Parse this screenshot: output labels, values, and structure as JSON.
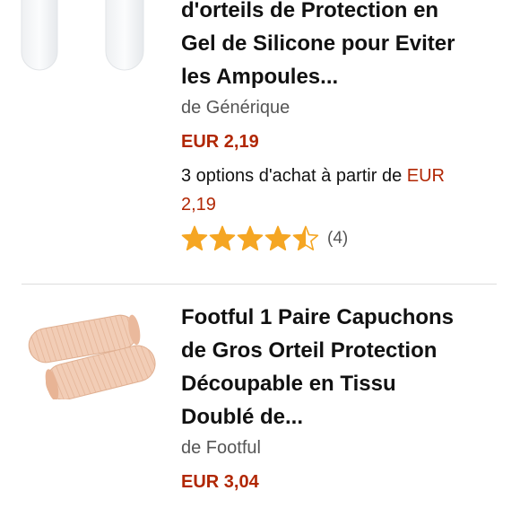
{
  "products": [
    {
      "title": "d'orteils de Protection en Gel de Silicone pour Eviter les Ampoules...",
      "title_lines": [
        "d'orteils de Protection en",
        "Gel de Silicone pour Eviter",
        "les Ampoules..."
      ],
      "brand": "de Générique",
      "price": "EUR 2,19",
      "offers_text": "3 options d'achat à partir de",
      "offers_currency": "EUR",
      "offers_amount": "2,19",
      "rating": 4.5,
      "review_count": "(4)",
      "image_icon": "silicone-gel-toe-cap-image"
    },
    {
      "title": "Footful 1 Paire Capuchons de Gros Orteil Protection Découpable en Tissu Doublé de...",
      "title_lines": [
        "Footful 1 Paire Capuchons",
        "de Gros Orteil Protection",
        "Découpable en Tissu",
        "Doublé de..."
      ],
      "brand": "de Footful",
      "price": "EUR 3,04",
      "image_icon": "fabric-toe-cap-image"
    }
  ],
  "colors": {
    "price": "#b12704",
    "star": "#f5a623",
    "divider": "#dddddd",
    "brand": "#555555"
  }
}
